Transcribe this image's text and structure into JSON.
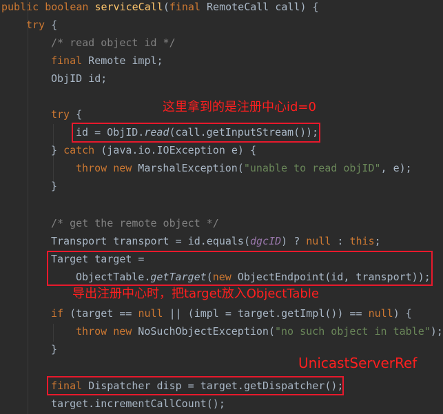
{
  "code": {
    "l1": {
      "kw1": "public",
      "kw2": "boolean",
      "fn": "serviceCall",
      "p1": "(",
      "kw3": "final",
      "rest": " RemoteCall call) {"
    },
    "l2": {
      "kw": "try",
      "rest": " {"
    },
    "l3": {
      "comment": "/* read object id */"
    },
    "l4": {
      "kw": "final",
      "rest": " Remote impl;"
    },
    "l5": {
      "text": "ObjID id;"
    },
    "l6": {
      "kw": "try",
      "rest": " {"
    },
    "l7": {
      "a": "id = ObjID.",
      "it": "read",
      "b": "(call.getInputStream());"
    },
    "l8": {
      "a": "} ",
      "kw": "catch",
      "b": " (java.io.IOException e) {"
    },
    "l9": {
      "kw1": "throw",
      "kw2": "new",
      "a": " MarshalException(",
      "str": "\"unable to read objID\"",
      "b": ", e);"
    },
    "l10": {
      "text": "}"
    },
    "l11": {
      "comment": "/* get the remote object */"
    },
    "l12": {
      "a": "Transport transport = id.equals(",
      "param": "dgcID",
      "b": ") ? ",
      "kw1": "null",
      "c": " : ",
      "kw2": "this",
      "d": ";"
    },
    "l13": {
      "text": "Target target ="
    },
    "l14": {
      "a": "ObjectTable.",
      "it": "getTarget",
      "b": "(",
      "kw": "new",
      "c": " ObjectEndpoint(id, transport));"
    },
    "l15": {
      "kw1": "if",
      "a": " (target == ",
      "kw2": "null",
      "b": " || (impl = target.getImpl()) == ",
      "kw3": "null",
      "c": ") {"
    },
    "l16": {
      "kw1": "throw",
      "kw2": "new",
      "a": " NoSuchObjectException(",
      "str": "\"no such object in table\"",
      "b": ");"
    },
    "l17": {
      "text": "}"
    },
    "l18": {
      "kw": "final",
      "rest": " Dispatcher disp = target.getDispatcher();"
    },
    "l19": {
      "text": "target.incrementCallCount();"
    }
  },
  "annotations": {
    "registry_id": "这里拿到的是注册中心id=0",
    "export_registry": "导出注册中心时，把target放入ObjectTable",
    "class_name": "UnicastServerRef"
  },
  "colors": {
    "background": "#2b2b2b",
    "keyword": "#cc7832",
    "function": "#ffc66d",
    "comment": "#808080",
    "string": "#6a8759",
    "field": "#9876aa",
    "text": "#a9b7c6",
    "annotation": "#e8192c"
  }
}
